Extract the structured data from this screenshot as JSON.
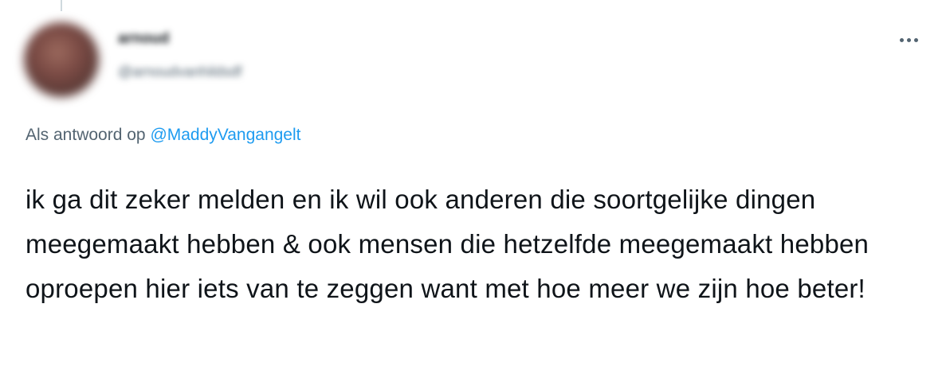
{
  "tweet": {
    "author_name": "arnoud",
    "author_handle": "@arnoudvanhildsdf",
    "more_icon": "more-horizontal-icon",
    "reply_prefix": "Als antwoord op",
    "reply_mention": "@MaddyVangangelt",
    "text": "ik ga dit zeker melden en ik wil ook anderen die soortgelijke dingen meegemaakt hebben & ook mensen die hetzelfde meegemaakt hebben oproepen hier iets van te zeggen want met hoe meer we zijn hoe beter!"
  },
  "colors": {
    "text_primary": "#0f1419",
    "text_secondary": "#536471",
    "link": "#1d9bf0",
    "thread_line": "#cfd9de"
  }
}
